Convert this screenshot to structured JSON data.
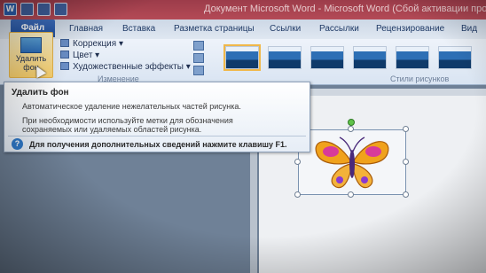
{
  "window": {
    "title": "Документ Microsoft Word - Microsoft Word (Сбой активации продукта)"
  },
  "ribbon_tabs": [
    {
      "label": "Файл"
    },
    {
      "label": "Главная"
    },
    {
      "label": "Вставка"
    },
    {
      "label": "Разметка страницы"
    },
    {
      "label": "Ссылки"
    },
    {
      "label": "Рассылки"
    },
    {
      "label": "Рецензирование"
    },
    {
      "label": "Вид"
    }
  ],
  "adjust_group": {
    "remove_bg_label": "Удалить фон",
    "correction_label": "Коррекция ▾",
    "color_label": "Цвет ▾",
    "artistic_label": "Художественные эффекты ▾",
    "group_label": "Изменение"
  },
  "styles_group": {
    "group_label": "Стили рисунков"
  },
  "tooltip": {
    "title": "Удалить фон",
    "line1": "Автоматическое удаление нежелательных частей рисунка.",
    "line2": "При необходимости используйте метки для обозначения",
    "line3": "сохраняемых или удаляемых областей рисунка.",
    "help": "Для получения дополнительных сведений нажмите клавишу F1."
  },
  "colors": {
    "title_bar": "#b44a56",
    "ribbon": "#dfe7f1",
    "file_tab": "#2b5fb0",
    "highlight": "#f6cd6a"
  },
  "icons": [
    "word-app-icon",
    "save-icon",
    "undo-icon",
    "redo-icon",
    "help-icon",
    "butterfly-picture"
  ]
}
